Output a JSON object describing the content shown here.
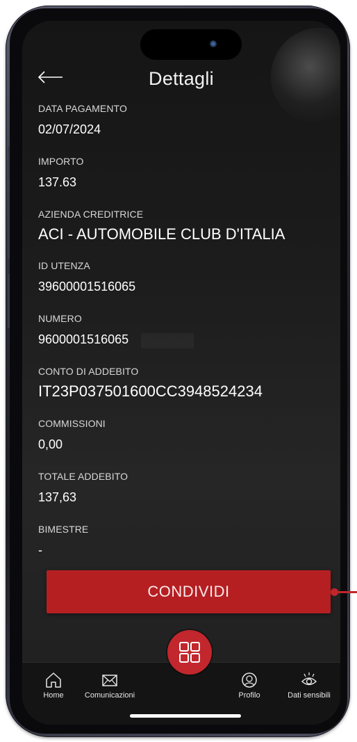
{
  "header": {
    "title": "Dettagli"
  },
  "fields": [
    {
      "label": "DATA PAGAMENTO",
      "value": "02/07/2024"
    },
    {
      "label": "IMPORTO",
      "value": "137.63"
    },
    {
      "label": "AZIENDA CREDITRICE",
      "value": "ACI - AUTOMOBILE CLUB D'ITALIA"
    },
    {
      "label": "ID UTENZA",
      "value": "39600001516065"
    },
    {
      "label": "NUMERO",
      "value": "9600001516065"
    },
    {
      "label": "CONTO DI ADDEBITO",
      "value": "IT23P037501600CC3948524234"
    },
    {
      "label": "COMMISSIONI",
      "value": "0,00"
    },
    {
      "label": "TOTALE ADDEBITO",
      "value": "137,63"
    },
    {
      "label": "BIMESTRE",
      "value": "-"
    }
  ],
  "share_button": {
    "label": "CONDIVIDI"
  },
  "tabbar": {
    "items": [
      {
        "label": "Home",
        "icon": "home-icon"
      },
      {
        "label": "Comunicazioni",
        "icon": "envelope-icon"
      },
      {
        "label": "",
        "icon": "grid-menu-icon"
      },
      {
        "label": "Profilo",
        "icon": "profile-icon"
      },
      {
        "label": "Dati sensibili",
        "icon": "eye-icon"
      }
    ]
  },
  "colors": {
    "accent": "#c1272d",
    "background": "#1c1c1c",
    "text": "#ffffff"
  }
}
